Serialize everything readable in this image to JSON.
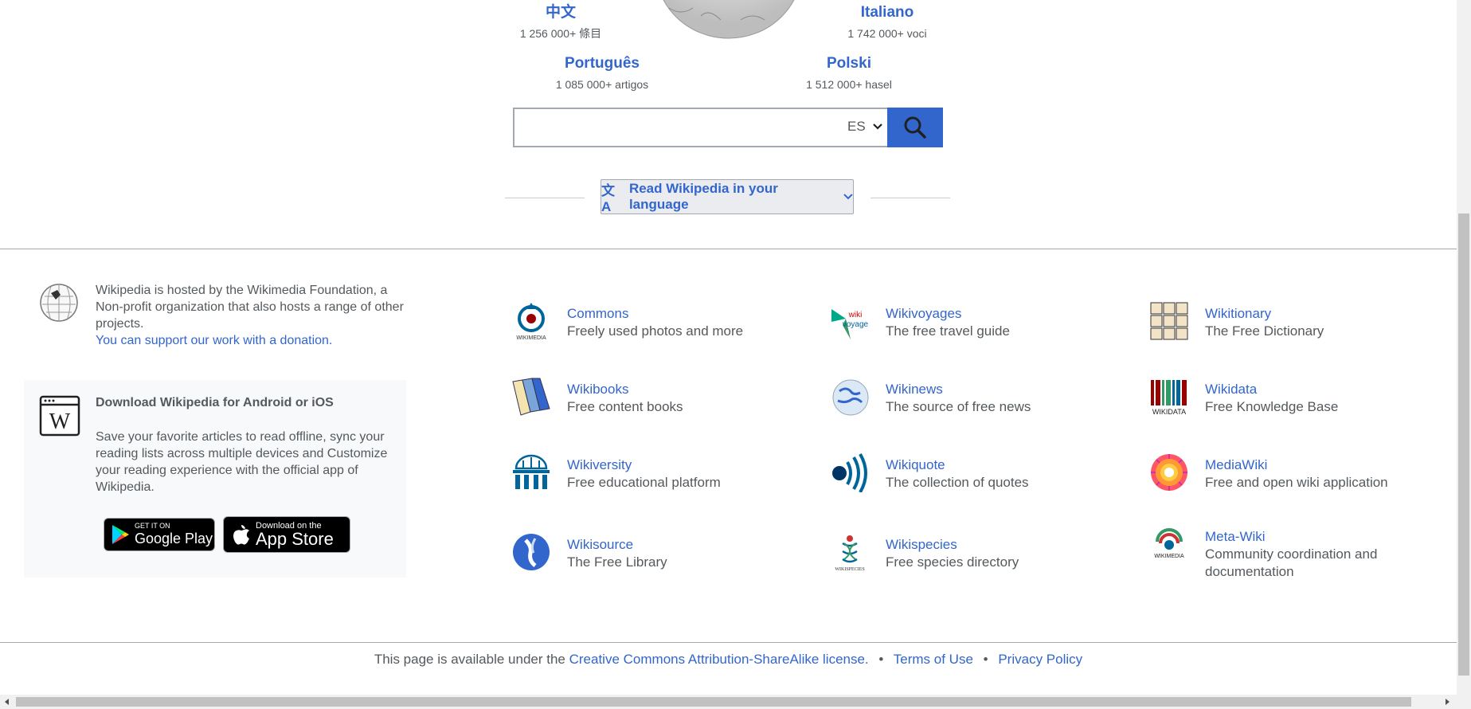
{
  "languages": [
    {
      "name": "中文",
      "count": "1 256 000+ 條目"
    },
    {
      "name": "Italiano",
      "count": "1 742 000+ voci"
    },
    {
      "name": "Português",
      "count": "1 085 000+ artigos"
    },
    {
      "name": "Polski",
      "count": "1 512 000+ hasel"
    }
  ],
  "search": {
    "value": "",
    "placeholder": "",
    "lang_code": "ES"
  },
  "read_language": {
    "icon_text": "文A",
    "label": "Read Wikipedia in your language"
  },
  "hosted": {
    "text": "Wikipedia is hosted by the Wikimedia Foundation, a Non-profit organization that also hosts a range of other projects.",
    "link": "You can support our work with a donation."
  },
  "app": {
    "title": "Download Wikipedia for Android or iOS",
    "description": "Save your favorite articles to read offline, sync your reading lists across multiple devices and Customize your reading experience with the official app of Wikipedia.",
    "google_play": {
      "small": "GET IT ON",
      "big": "Google Play"
    },
    "app_store": {
      "small": "Download on the",
      "big": "App Store"
    }
  },
  "projects": [
    {
      "name": "Commons",
      "desc": "Freely used photos and more"
    },
    {
      "name": "Wikivoyages",
      "desc": "The free travel guide"
    },
    {
      "name": "Wikitionary",
      "desc": "The Free Dictionary"
    },
    {
      "name": "Wikibooks",
      "desc": "Free content books"
    },
    {
      "name": "Wikinews",
      "desc": "The source of free news"
    },
    {
      "name": "Wikidata",
      "desc": "Free Knowledge Base"
    },
    {
      "name": "Wikiversity",
      "desc": "Free educational platform"
    },
    {
      "name": "Wikiquote",
      "desc": "The collection of quotes"
    },
    {
      "name": "MediaWiki",
      "desc": "Free and open wiki application"
    },
    {
      "name": "Wikisource",
      "desc": "The Free Library"
    },
    {
      "name": "Wikispecies",
      "desc": "Free species directory"
    },
    {
      "name": "Meta-Wiki",
      "desc": "Community coordination and documentation"
    }
  ],
  "footer": {
    "text": "This page is available under the",
    "license": "Creative Commons Attribution-ShareAlike license.",
    "terms": "Terms of Use",
    "privacy": "Privacy Policy"
  },
  "colors": {
    "link": "#3366cc",
    "text": "#54595d",
    "button": "#3366cc"
  }
}
